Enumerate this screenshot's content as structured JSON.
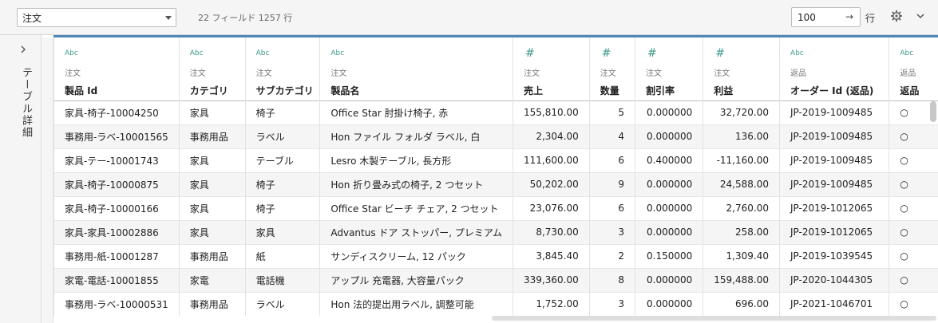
{
  "toolbar": {
    "datasource": "注文",
    "field_info": "22 フィールド 1257 行",
    "row_count": "100",
    "rows_label": "行"
  },
  "side_panel": {
    "title": "テーブル詳細"
  },
  "columns": [
    {
      "type": "Abc",
      "table": "注文",
      "name": "製品 Id",
      "align": "left"
    },
    {
      "type": "Abc",
      "table": "注文",
      "name": "カテゴリ",
      "align": "left"
    },
    {
      "type": "Abc",
      "table": "注文",
      "name": "サブカテゴリ",
      "align": "left"
    },
    {
      "type": "Abc",
      "table": "注文",
      "name": "製品名",
      "align": "left"
    },
    {
      "type": "#",
      "table": "注文",
      "name": "売上",
      "align": "right"
    },
    {
      "type": "#",
      "table": "注文",
      "name": "数量",
      "align": "right"
    },
    {
      "type": "#",
      "table": "注文",
      "name": "割引率",
      "align": "right"
    },
    {
      "type": "#",
      "table": "注文",
      "name": "利益",
      "align": "right"
    },
    {
      "type": "Abc",
      "table": "返品",
      "name": "オーダー Id (返品)",
      "align": "left"
    },
    {
      "type": "Abc",
      "table": "返品",
      "name": "返品",
      "align": "left"
    }
  ],
  "rows": [
    [
      "家具-椅子-10004250",
      "家具",
      "椅子",
      "Office Star 肘掛け椅子, 赤",
      "155,810.00",
      "5",
      "0.000000",
      "32,720.00",
      "JP-2019-1009485",
      "○"
    ],
    [
      "事務用-ラベ-10001565",
      "事務用品",
      "ラベル",
      "Hon ファイル フォルダ ラベル, 白",
      "2,304.00",
      "4",
      "0.000000",
      "136.00",
      "JP-2019-1009485",
      "○"
    ],
    [
      "家具-テー-10001743",
      "家具",
      "テーブル",
      "Lesro 木製テーブル, 長方形",
      "111,600.00",
      "6",
      "0.400000",
      "-11,160.00",
      "JP-2019-1009485",
      "○"
    ],
    [
      "家具-椅子-10000875",
      "家具",
      "椅子",
      "Hon 折り畳み式の椅子, 2 つセット",
      "50,202.00",
      "9",
      "0.000000",
      "24,588.00",
      "JP-2019-1009485",
      "○"
    ],
    [
      "家具-椅子-10000166",
      "家具",
      "椅子",
      "Office Star ビーチ チェア, 2 つセット",
      "23,076.00",
      "6",
      "0.000000",
      "2,760.00",
      "JP-2019-1012065",
      "○"
    ],
    [
      "家具-家具-10002886",
      "家具",
      "家具",
      "Advantus ドア ストッパー, プレミアム",
      "8,730.00",
      "3",
      "0.000000",
      "258.00",
      "JP-2019-1012065",
      "○"
    ],
    [
      "事務用-紙-10001287",
      "事務用品",
      "紙",
      "サンディスクリーム, 12 パック",
      "3,845.40",
      "2",
      "0.150000",
      "1,309.40",
      "JP-2019-1039545",
      "○"
    ],
    [
      "家電-電話-10001855",
      "家電",
      "電話機",
      "アップル 充電器, 大容量パック",
      "339,360.00",
      "8",
      "0.000000",
      "159,488.00",
      "JP-2020-1044305",
      "○"
    ],
    [
      "事務用-ラベ-10000531",
      "事務用品",
      "ラベル",
      "Hon 法的提出用ラベル, 調整可能",
      "1,752.00",
      "3",
      "0.000000",
      "696.00",
      "JP-2021-1046701",
      "○"
    ]
  ]
}
